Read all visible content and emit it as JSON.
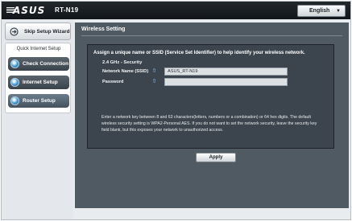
{
  "header": {
    "logo_text": "ASUS",
    "model": "RT-N19",
    "language": {
      "selected": "English"
    }
  },
  "sidebar": {
    "skip_label": "Skip Setup Wizard",
    "qis_title": "Quick Internet Setup",
    "steps": [
      {
        "label": "Check Connection",
        "icon": "globe-icon"
      },
      {
        "label": "Internet Setup",
        "icon": "globe-icon"
      },
      {
        "label": "Router Setup",
        "icon": "globe-icon"
      }
    ]
  },
  "main": {
    "title": "Wireless Setting",
    "instruction": "Assign a unique name or SSID (Service Set Identifier) to help identify your wireless network.",
    "band_label": "2.4 GHz - Security",
    "fields": {
      "ssid": {
        "label": "Network Name (SSID)",
        "value": "ASUS_RT-N19"
      },
      "password": {
        "label": "Password",
        "value": ""
      }
    },
    "note": "Enter a network key between 8 and 63 characters(letters, numbers or a combination) or 64 hex digits. The default wireless security setting is WPA2-Personal AES. If you do not want to set the network security, leave the security key field blank, but this exposes your network to unauthorized access.",
    "apply_label": "Apply"
  },
  "colors": {
    "topbar": "#1a1e22",
    "content_bg": "#3c454e",
    "accent_icon": "#8fc3ea"
  }
}
